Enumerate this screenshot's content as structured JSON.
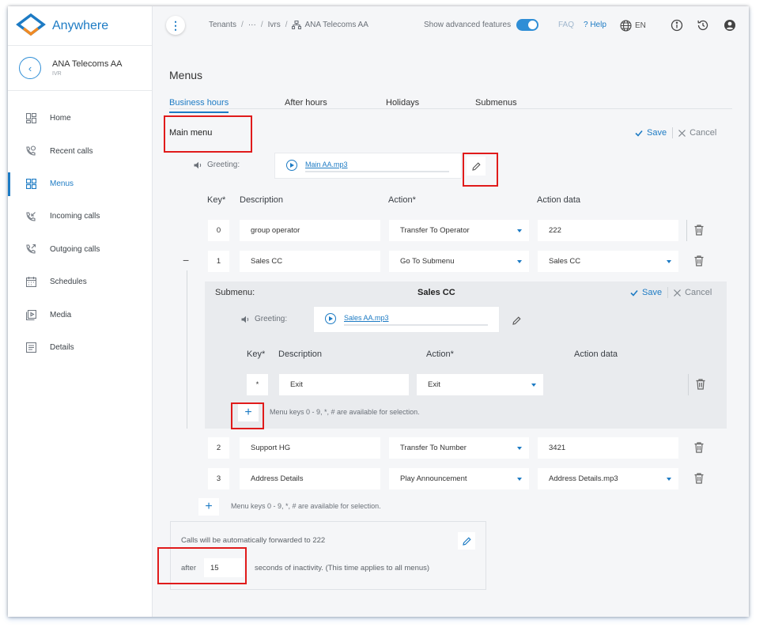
{
  "brand": {
    "name": "Anywhere"
  },
  "tenant": {
    "name": "ANA Telecoms AA",
    "sub": "IVR"
  },
  "nav": [
    {
      "label": "Home",
      "icon": "dashboard-icon"
    },
    {
      "label": "Recent calls",
      "icon": "phone-clock-icon"
    },
    {
      "label": "Menus",
      "icon": "menu-grid-icon",
      "active": true
    },
    {
      "label": "Incoming calls",
      "icon": "phone-incoming-icon"
    },
    {
      "label": "Outgoing calls",
      "icon": "phone-outgoing-icon"
    },
    {
      "label": "Schedules",
      "icon": "calendar-icon"
    },
    {
      "label": "Media",
      "icon": "media-icon"
    },
    {
      "label": "Details",
      "icon": "details-icon"
    }
  ],
  "topbar": {
    "breadcrumb": [
      "Tenants",
      "···",
      "Ivrs",
      "ANA Telecoms AA"
    ],
    "advanced_label": "Show advanced features",
    "advanced_on": true,
    "faq": "FAQ",
    "help": "? Help",
    "lang": "EN"
  },
  "page": {
    "title": "Menus",
    "tabs": [
      "Business hours",
      "After hours",
      "Holidays",
      "Submenus"
    ]
  },
  "main_menu": {
    "title": "Main menu",
    "save": "Save",
    "cancel": "Cancel",
    "greeting_label": "Greeting:",
    "greeting_file": "Main AA.mp3",
    "headers": {
      "key": "Key*",
      "description": "Description",
      "action": "Action*",
      "action_data": "Action data"
    },
    "rows": [
      {
        "key": "0",
        "description": "group operator",
        "action": "Transfer To Operator",
        "data": "222",
        "data_select": false
      },
      {
        "key": "1",
        "description": "Sales CC",
        "action": "Go To Submenu",
        "data": "Sales CC",
        "data_select": true
      },
      {
        "key": "2",
        "description": "Support HG",
        "action": "Transfer To Number",
        "data": "3421",
        "data_select": false
      },
      {
        "key": "3",
        "description": "Address Details",
        "action": "Play Announcement",
        "data": "Address Details.mp3",
        "data_select": true
      }
    ],
    "hint": "Menu keys 0 - 9, *, # are available for selection."
  },
  "submenu": {
    "label": "Submenu:",
    "name": "Sales CC",
    "save": "Save",
    "cancel": "Cancel",
    "greeting_label": "Greeting:",
    "greeting_file": "Sales AA.mp3",
    "headers": {
      "key": "Key*",
      "description": "Description",
      "action": "Action*",
      "action_data": "Action data"
    },
    "rows": [
      {
        "key": "*",
        "description": "Exit",
        "action": "Exit"
      }
    ],
    "hint": "Menu keys 0 - 9, *, # are available for selection."
  },
  "forward": {
    "text": "Calls will be automatically forwarded to 222",
    "after": "after",
    "seconds": "15",
    "rest": "seconds of inactivity. (This time applies to all menus)"
  },
  "colors": {
    "accent": "#1d7bc4",
    "highlight": "#e01b1b"
  }
}
